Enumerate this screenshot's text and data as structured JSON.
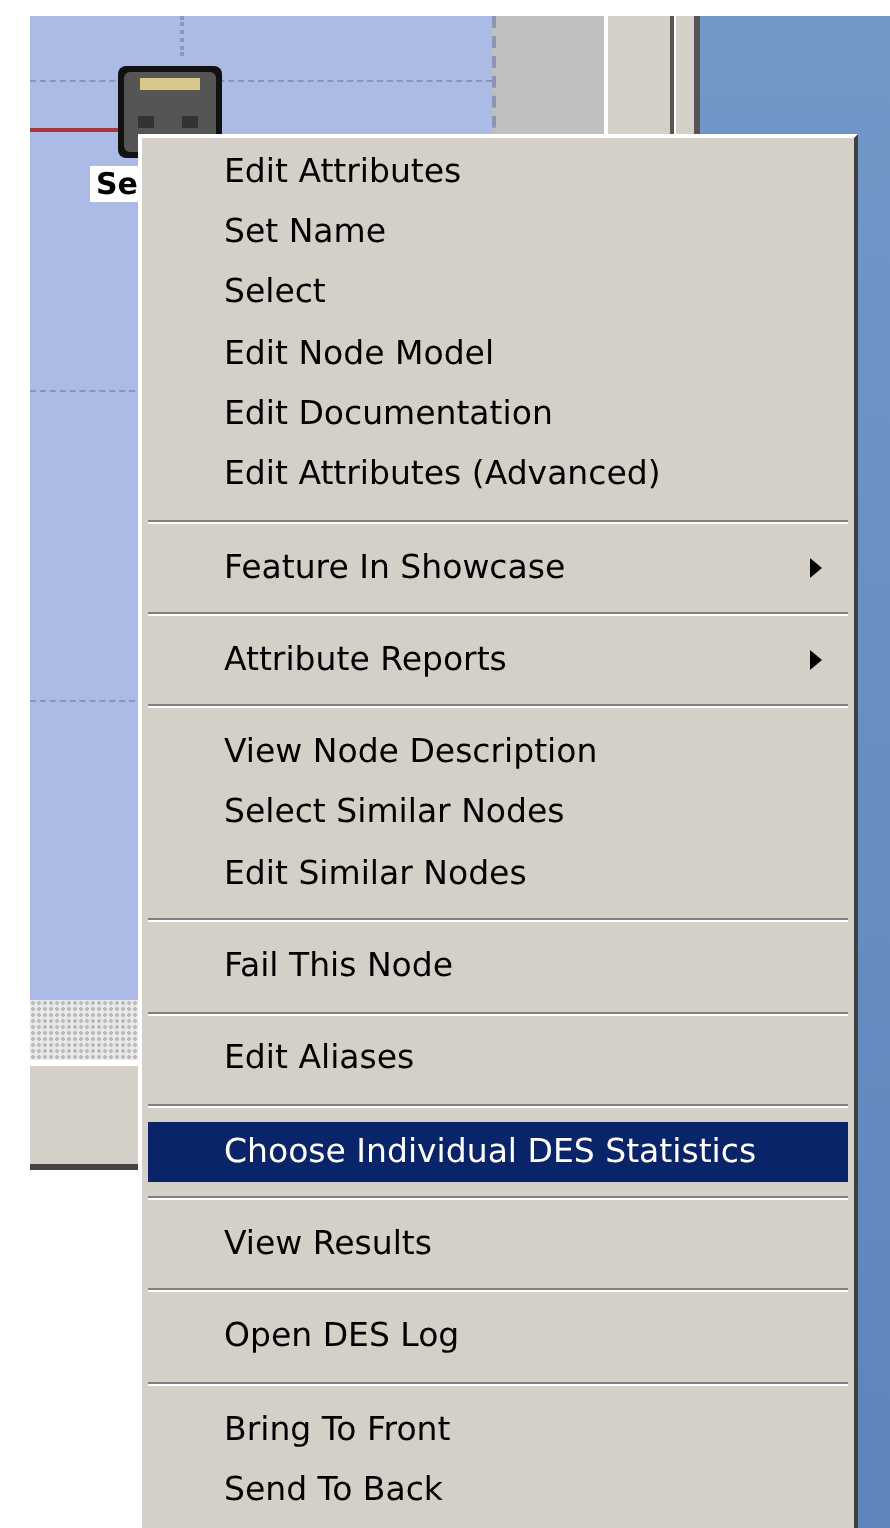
{
  "canvas": {
    "node": {
      "label": "Se"
    }
  },
  "context_menu": {
    "items": [
      {
        "kind": "item",
        "label": "Edit Attributes",
        "selected": false,
        "submenu": false
      },
      {
        "kind": "item",
        "label": "Set Name",
        "selected": false,
        "submenu": false
      },
      {
        "kind": "item",
        "label": "Select",
        "selected": false,
        "submenu": false
      },
      {
        "kind": "item",
        "label": "Edit Node Model",
        "selected": false,
        "submenu": false
      },
      {
        "kind": "item",
        "label": "Edit Documentation",
        "selected": false,
        "submenu": false
      },
      {
        "kind": "item",
        "label": "Edit Attributes (Advanced)",
        "selected": false,
        "submenu": false
      },
      {
        "kind": "separator"
      },
      {
        "kind": "item",
        "label": "Feature In Showcase",
        "selected": false,
        "submenu": true
      },
      {
        "kind": "separator"
      },
      {
        "kind": "item",
        "label": "Attribute Reports",
        "selected": false,
        "submenu": true
      },
      {
        "kind": "separator"
      },
      {
        "kind": "item",
        "label": "View Node Description",
        "selected": false,
        "submenu": false
      },
      {
        "kind": "item",
        "label": "Select Similar Nodes",
        "selected": false,
        "submenu": false
      },
      {
        "kind": "item",
        "label": "Edit Similar Nodes",
        "selected": false,
        "submenu": false
      },
      {
        "kind": "separator"
      },
      {
        "kind": "item",
        "label": "Fail This Node",
        "selected": false,
        "submenu": false
      },
      {
        "kind": "separator"
      },
      {
        "kind": "item",
        "label": "Edit Aliases",
        "selected": false,
        "submenu": false
      },
      {
        "kind": "separator"
      },
      {
        "kind": "item",
        "label": "Choose Individual DES Statistics",
        "selected": true,
        "submenu": false
      },
      {
        "kind": "separator"
      },
      {
        "kind": "item",
        "label": "View Results",
        "selected": false,
        "submenu": false
      },
      {
        "kind": "separator"
      },
      {
        "kind": "item",
        "label": "Open DES Log",
        "selected": false,
        "submenu": false
      },
      {
        "kind": "separator"
      },
      {
        "kind": "item",
        "label": "Bring To Front",
        "selected": false,
        "submenu": false
      },
      {
        "kind": "item",
        "label": "Send To Back",
        "selected": false,
        "submenu": false
      }
    ]
  }
}
